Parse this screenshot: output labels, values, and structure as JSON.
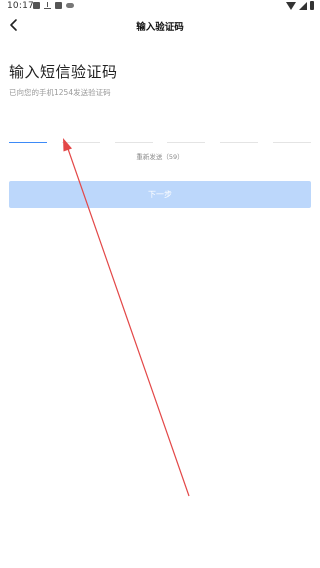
{
  "status_bar": {
    "time": "10:17",
    "left_icons": [
      "image-icon",
      "download-icon",
      "notification-icon",
      "cloud-icon"
    ],
    "right_icons": [
      "wifi-icon",
      "signal-icon",
      "battery-icon"
    ]
  },
  "nav": {
    "back_icon": "chevron-left-icon",
    "title": "输入验证码"
  },
  "main": {
    "heading": "输入短信验证码",
    "subtext": "已向您的手机1254发送验证码",
    "code_cells": [
      "",
      "",
      "",
      "",
      "",
      ""
    ],
    "active_cell_index": 0,
    "resend_label": "重新发送（59）",
    "next_button_label": "下一步"
  },
  "annotation": {
    "type": "arrow",
    "color": "#e34848"
  },
  "colors": {
    "accent": "#3d8af7",
    "button_disabled": "#bcd7fb",
    "muted_text": "#9a9a9a"
  }
}
